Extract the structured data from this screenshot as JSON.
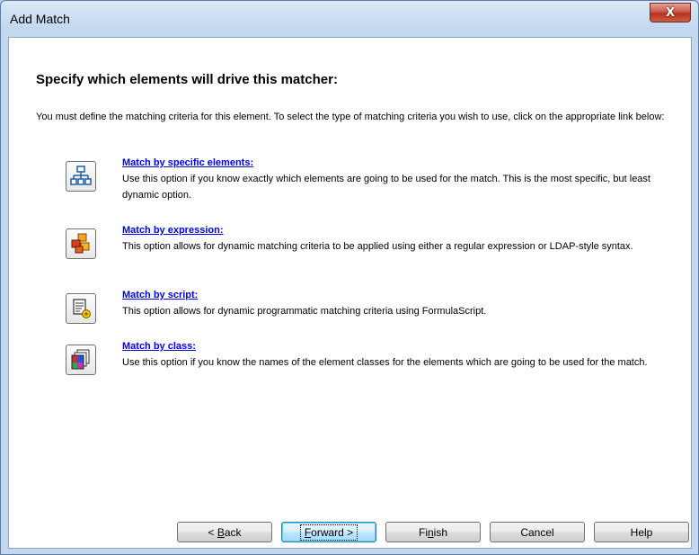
{
  "window": {
    "title": "Add Match",
    "close_glyph": "X"
  },
  "heading": "Specify which elements will drive this matcher:",
  "intro": "You must define the matching criteria for this element. To select the type of matching criteria you wish to use, click on the appropriate link below:",
  "options": [
    {
      "icon": "hierarchy-icon",
      "link": "Match by specific elements:",
      "description": "Use this option if you know exactly which elements are going to be used for the match. This is the most specific, but least dynamic option."
    },
    {
      "icon": "expression-blocks-icon",
      "link": "Match by expression:",
      "description": "This option allows for dynamic matching criteria to be applied using either a regular expression or LDAP-style syntax."
    },
    {
      "icon": "script-gear-icon",
      "link": "Match by script:",
      "description": "This option allows for dynamic programmatic matching criteria using FormulaScript."
    },
    {
      "icon": "class-stack-icon",
      "link": "Match by class:",
      "description": "Use this option if you know the names of the element classes for the elements which are going to be used for the match."
    }
  ],
  "buttons": {
    "back": {
      "prefix": "< ",
      "mnemonic": "B",
      "rest": "ack"
    },
    "forward": {
      "mnemonic": "F",
      "rest": "orward >"
    },
    "finish": {
      "pre": "Fi",
      "mnemonic": "n",
      "rest": "ish"
    },
    "cancel": "Cancel",
    "help": "Help"
  },
  "colors": {
    "link": "#0000ee",
    "close_button": "#c74b37",
    "default_button_border": "#3c7fb1"
  }
}
